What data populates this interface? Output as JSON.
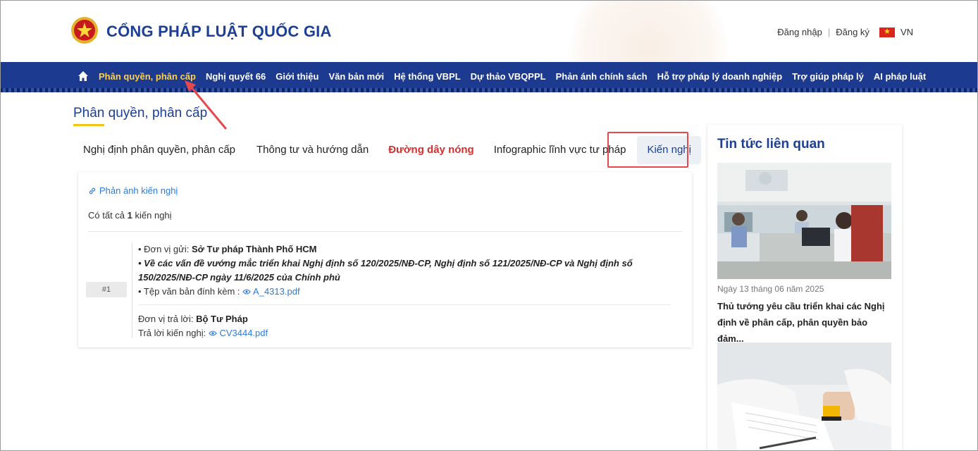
{
  "header": {
    "site_title": "CỔNG PHÁP LUẬT QUỐC GIA",
    "login": "Đăng nhập",
    "separator": "|",
    "register": "Đăng ký",
    "language": "VN"
  },
  "nav": {
    "items": [
      {
        "label": "Phân quyền, phân cấp",
        "active": true
      },
      {
        "label": "Nghị quyết 66"
      },
      {
        "label": "Giới thiệu"
      },
      {
        "label": "Văn bản mới"
      },
      {
        "label": "Hệ thống VBPL"
      },
      {
        "label": "Dự thảo VBQPPL"
      },
      {
        "label": "Phản ánh chính sách"
      },
      {
        "label": "Hỗ trợ pháp lý doanh nghiệp"
      },
      {
        "label": "Trợ giúp pháp lý"
      },
      {
        "label": "AI pháp luật"
      }
    ]
  },
  "page": {
    "title": "Phân quyền, phân cấp"
  },
  "tabs": [
    {
      "label": "Nghị định phân quyền, phân cấp"
    },
    {
      "label": "Thông tư và hướng dẫn"
    },
    {
      "label": "Đường dây nóng"
    },
    {
      "label": "Infographic lĩnh vực tư pháp"
    },
    {
      "label": "Kiến nghị",
      "selected": true
    }
  ],
  "card": {
    "link_label": "Phản ánh kiến nghị",
    "count_prefix": "Có tất cả",
    "count_value": "1",
    "count_suffix": "kiến nghị",
    "record": {
      "index": "#1",
      "sender_label": "• Đơn vị gửi:",
      "sender_value": "Sở Tư pháp Thành Phố HCM",
      "subject": "• Về các vấn đề vướng mắc triển khai Nghị định số 120/2025/NĐ-CP, Nghị định số 121/2025/NĐ-CP và Nghị định số 150/2025/NĐ-CP ngày 11/6/2025 của Chính phủ",
      "attachment_label": "• Tệp văn bản đính kèm :",
      "attachment_file": "A_4313.pdf",
      "responder_label": "Đơn vị trả lời:",
      "responder_value": "Bộ Tư Pháp",
      "reply_label": "Trả lời kiến nghị:",
      "reply_file": "CV3444.pdf"
    }
  },
  "sidebar": {
    "title": "Tin tức liên quan",
    "news": [
      {
        "date": "Ngày 13 tháng 06 năm 2025",
        "title": "Thủ tướng yêu cầu triển khai các Nghị định về phân cấp, phân quyền bảo đảm..."
      }
    ]
  },
  "colors": {
    "brand_blue": "#1d3f94",
    "nav_bg": "#1c3a8f",
    "nav_active": "#ffd24a",
    "hotline_red": "#d32f2f",
    "link_blue": "#2f7bd6",
    "annotation_red": "#e5484d"
  }
}
